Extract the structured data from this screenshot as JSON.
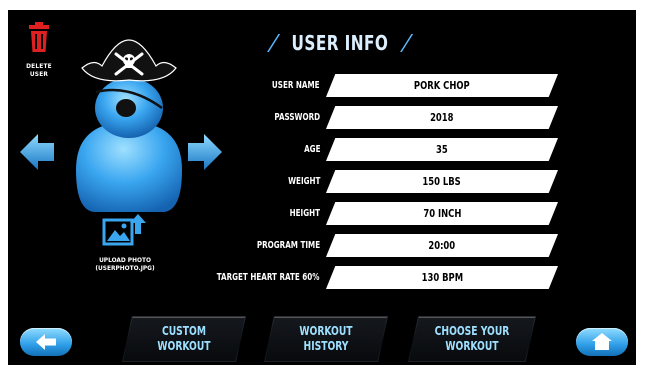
{
  "delete_user": {
    "label_line1": "DELETE",
    "label_line2": "USER",
    "icon": "trash-icon",
    "color": "#e02020"
  },
  "avatar": {
    "icon": "pirate-avatar-icon",
    "color": "#3aa6f0"
  },
  "upload": {
    "label_line1": "UPLOAD PHOTO",
    "label_line2": "(USERPHOTO.JPG)",
    "icon": "upload-photo-icon"
  },
  "title": "USER INFO",
  "fields": [
    {
      "label": "USER NAME",
      "value": "PORK CHOP"
    },
    {
      "label": "PASSWORD",
      "value": "2018"
    },
    {
      "label": "AGE",
      "value": "35"
    },
    {
      "label": "WEIGHT",
      "value": "150 LBS"
    },
    {
      "label": "HEIGHT",
      "value": "70 INCH"
    },
    {
      "label": "PROGRAM TIME",
      "value": "20:00"
    },
    {
      "label": "TARGET HEART RATE 60%",
      "value": "130 BPM"
    }
  ],
  "buttons": {
    "custom_workout": {
      "line1": "CUSTOM",
      "line2": "WORKOUT"
    },
    "workout_history": {
      "line1": "WORKOUT",
      "line2": "HISTORY"
    },
    "choose_workout": {
      "line1": "CHOOSE YOUR",
      "line2": "WORKOUT"
    }
  },
  "accent_color": "#3aa6f0"
}
